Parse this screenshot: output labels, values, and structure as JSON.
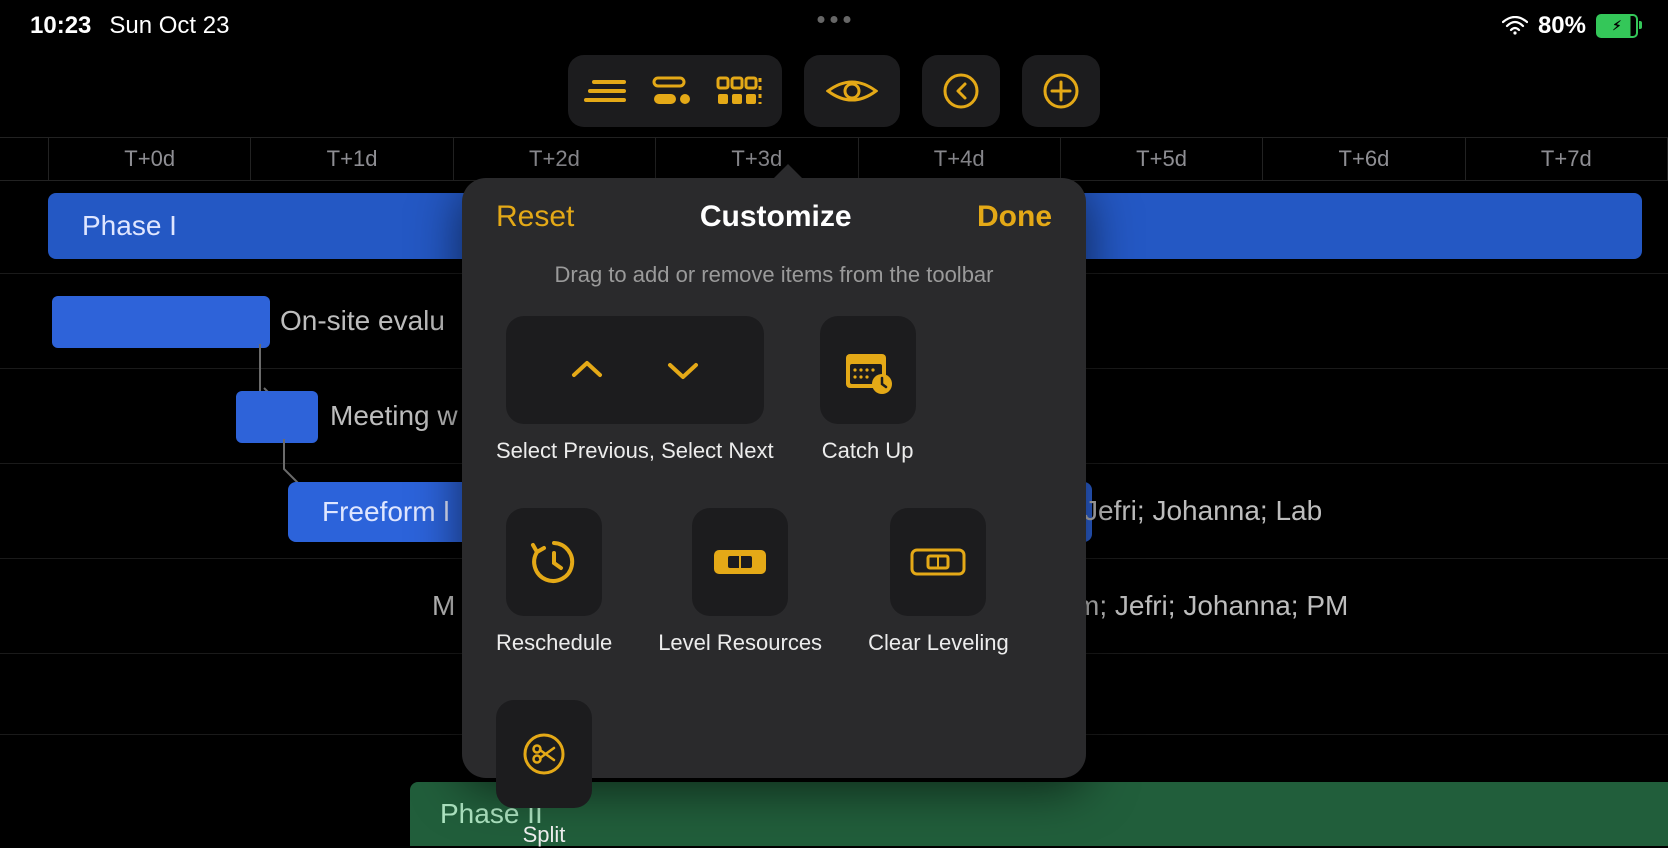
{
  "status": {
    "time": "10:23",
    "date": "Sun Oct 23",
    "battery_pct": "80%"
  },
  "timeline": {
    "headers": [
      "T+0d",
      "T+1d",
      "T+2d",
      "T+3d",
      "T+4d",
      "T+5d",
      "T+6d",
      "T+7d"
    ]
  },
  "tasks": {
    "phase1": "Phase I",
    "onsite": "On-site evalu",
    "meeting": "Meeting w",
    "freeform": "Freeform l",
    "mo": "M",
    "res1": "Jefri; Johanna; Lab",
    "res2": "m; Jefri; Johanna; PM",
    "phase2": "Phase II"
  },
  "popover": {
    "reset": "Reset",
    "title": "Customize",
    "done": "Done",
    "subtitle": "Drag to add or remove items from the toolbar",
    "items": {
      "select": "Select Previous, Select Next",
      "catchup": "Catch Up",
      "reschedule": "Reschedule",
      "level": "Level Resources",
      "clear": "Clear Leveling",
      "split": "Split"
    }
  }
}
